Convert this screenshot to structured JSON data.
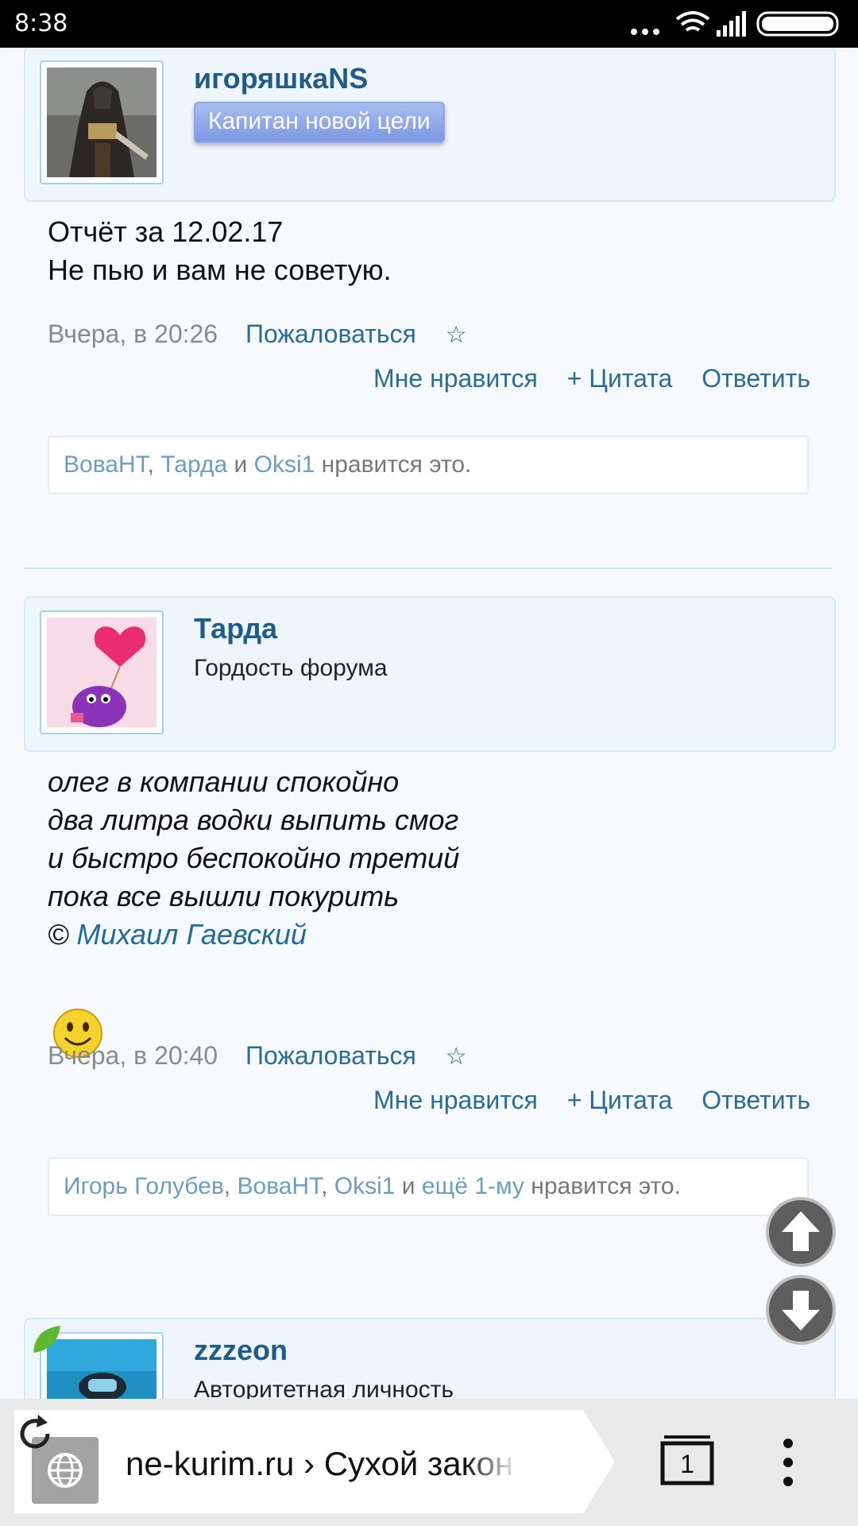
{
  "status_bar": {
    "time": "8:38",
    "icons": [
      "dots-icon",
      "wifi-icon",
      "signal-icon",
      "battery-icon"
    ]
  },
  "posts": [
    {
      "author": "игоряшкаNS",
      "title": "Капитан новой цели",
      "title_style": "badge",
      "message_lines": [
        "Отчёт за 12.02.17",
        "Не пью и вам не советую."
      ],
      "timestamp": "Вчера, в 20:26",
      "report": "Пожаловаться",
      "star": "☆",
      "actions": [
        "Мне нравится",
        "+ Цитата",
        "Ответить"
      ],
      "likes": {
        "users": [
          "ВоваНТ",
          "Тарда",
          "Oksi1"
        ],
        "sep1": ", ",
        "sep2": " и ",
        "suffix": " нравится это."
      }
    },
    {
      "author": "Тарда",
      "title": "Гордость форума",
      "message_lines": [
        "олег в компании спокойно",
        "два литра водки выпить смог",
        "и быстро беспокойно третий",
        "пока все вышли покурить"
      ],
      "copyright": "© ",
      "copyright_link": "Михаил Гаевский",
      "emoji": "smile-emoji",
      "timestamp": "Вчера, в 20:40",
      "report": "Пожаловаться",
      "star": "☆",
      "actions": [
        "Мне нравится",
        "+ Цитата",
        "Ответить"
      ],
      "likes": {
        "users": [
          "Игорь Голубев",
          "ВоваНТ",
          "Oksi1"
        ],
        "sep1": ", ",
        "sep2": ", ",
        "sep3": " и ",
        "more": "ещё 1-му",
        "suffix": " нравится это."
      }
    },
    {
      "author": "zzzeon",
      "title": "Авторитетная личность"
    }
  ],
  "browser": {
    "url": "ne-kurim.ru › Сухой закон",
    "tab_count": "1"
  },
  "colors": {
    "author": "#1f5c8a",
    "link": "#2a6c98",
    "badge": "#8fa5e8",
    "panel": "#eef6fc"
  }
}
